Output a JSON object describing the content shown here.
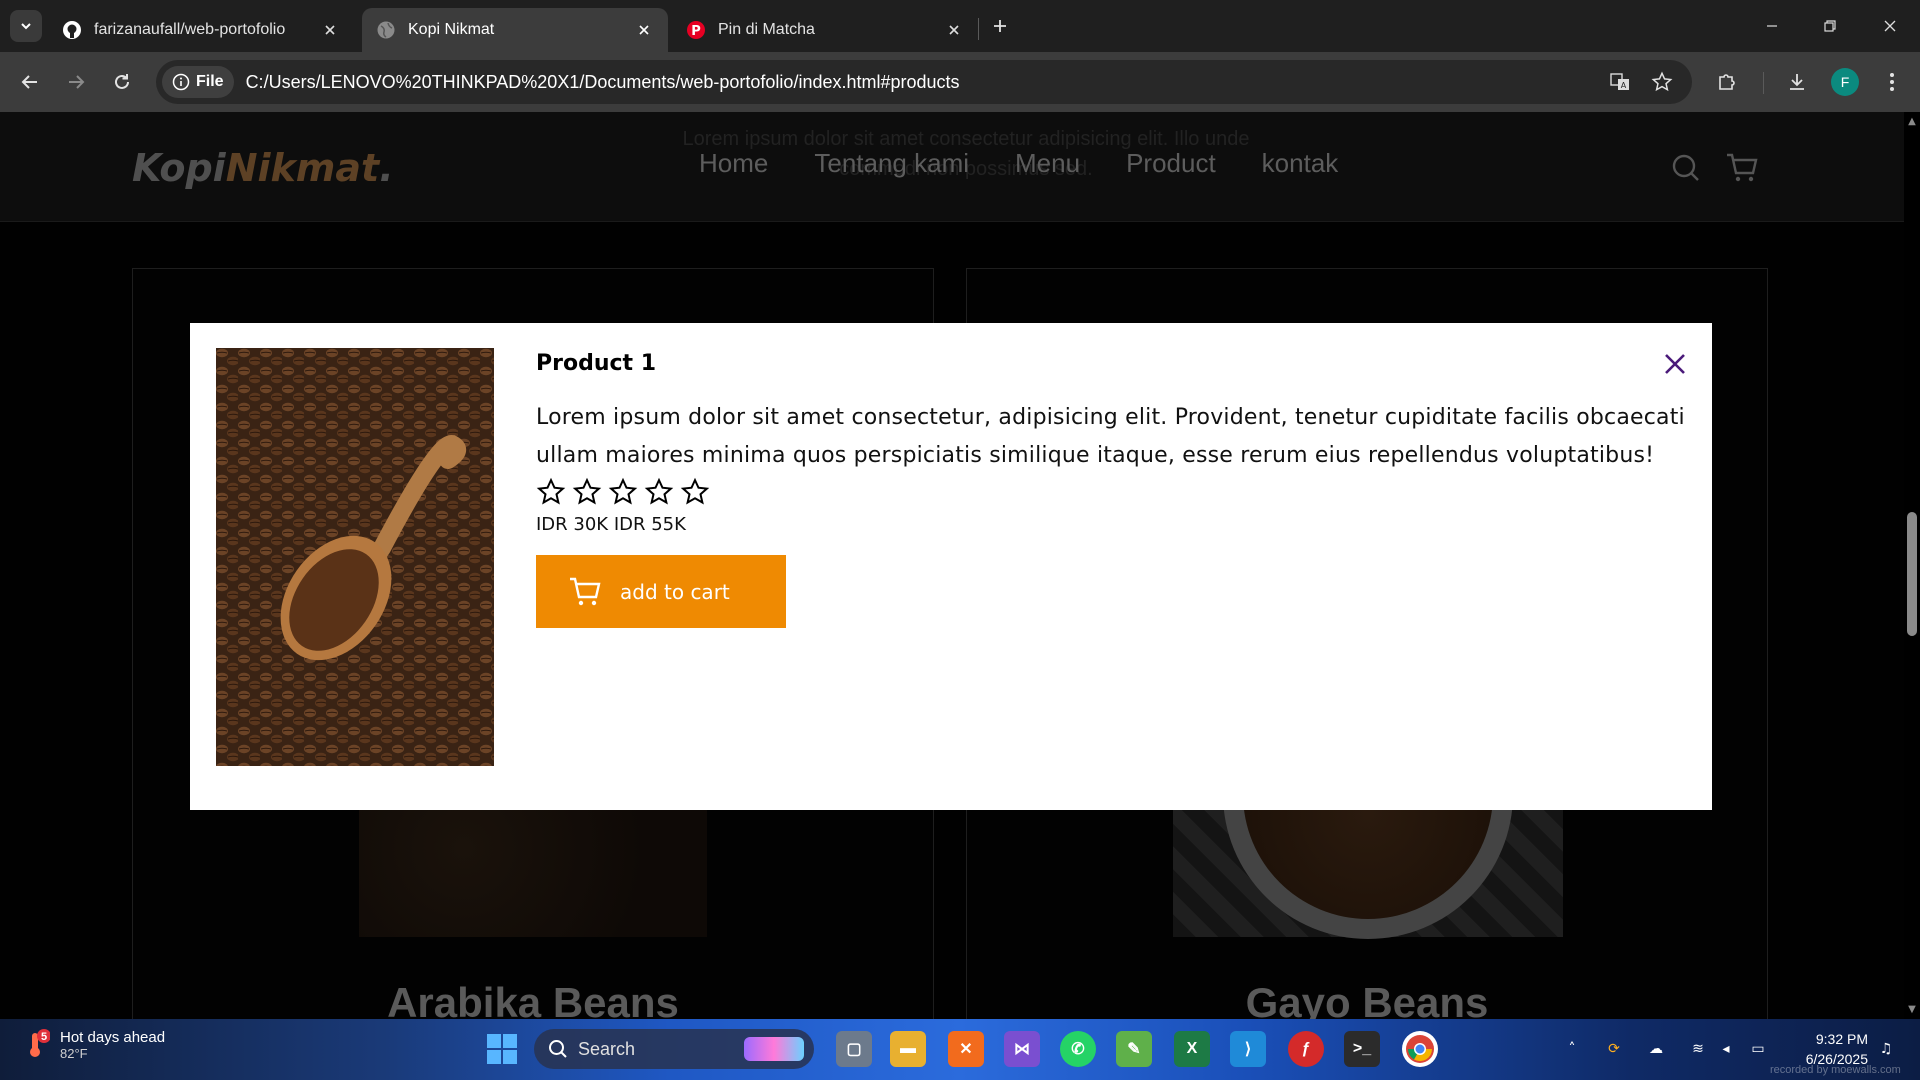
{
  "browser": {
    "tabs": [
      {
        "title": "farizanaufall/web-portofolio",
        "icon": "github-icon",
        "active": false
      },
      {
        "title": "Kopi Nikmat",
        "icon": "globe-icon",
        "active": true
      },
      {
        "title": "Pin di Matcha",
        "icon": "pinterest-icon",
        "active": false
      }
    ],
    "address": {
      "chip_label": "File",
      "url": "C:/Users/LENOVO%20THINKPAD%20X1/Documents/web-portofolio/index.html#products"
    },
    "profile_initial": "F"
  },
  "site": {
    "logo_main": "Kopi",
    "logo_accent": "Nikmat",
    "logo_dot": ".",
    "nav": [
      "Home",
      "Tentang kami",
      "Menu",
      "Product",
      "kontak"
    ],
    "ghost_text": "Lorem ipsum dolor sit amet consectetur adipisicing elit. Illo unde commodi non possimus sed.",
    "cards": [
      {
        "title": "Arabika Beans"
      },
      {
        "title": "Gayo Beans"
      }
    ]
  },
  "modal": {
    "title": "Product 1",
    "description": "Lorem ipsum dolor sit amet consectetur, adipisicing elit. Provident, tenetur cupiditate facilis obcaecati ullam maiores minima quos perspiciatis similique itaque, esse rerum eius repellendus voluptatibus!",
    "rating_stars": 5,
    "price": "IDR 30K IDR 55K",
    "cart_label": "add to cart"
  },
  "taskbar": {
    "weather_title": "Hot days ahead",
    "weather_temp": "82°F",
    "weather_badge": "5",
    "search_label": "Search",
    "time": "9:32 PM",
    "date": "6/26/2025",
    "watermark": "recorded by moewalls.com"
  },
  "colors": {
    "accent_orange": "#ef8a02",
    "close_purple": "#4a1a7a"
  }
}
